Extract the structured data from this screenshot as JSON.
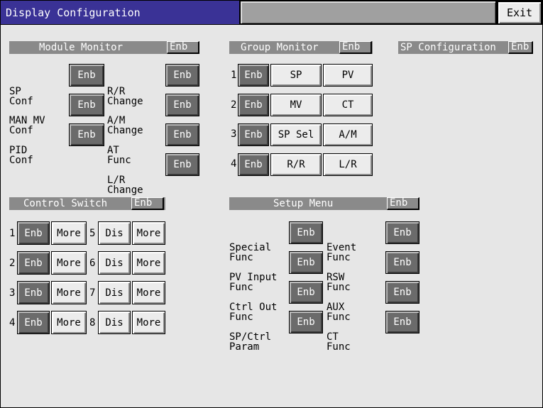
{
  "title_bar": {
    "title": "Display Configuration",
    "exit_label": "Exit"
  },
  "module_monitor": {
    "header": "Module Monitor",
    "header_tag": "Enb",
    "left_items": [
      {
        "l1": "SP",
        "l2": "Conf",
        "state": "Enb"
      },
      {
        "l1": "MAN MV",
        "l2": "Conf",
        "state": "Enb"
      },
      {
        "l1": "PID",
        "l2": "Conf",
        "state": "Enb"
      }
    ],
    "right_items": [
      {
        "l1": "R/R",
        "l2": "Change",
        "state": "Enb"
      },
      {
        "l1": "A/M",
        "l2": "Change",
        "state": "Enb"
      },
      {
        "l1": "AT",
        "l2": "Func",
        "state": "Enb"
      },
      {
        "l1": "L/R",
        "l2": "Change",
        "state": "Enb"
      }
    ]
  },
  "group_monitor": {
    "header": "Group Monitor",
    "header_tag": "Enb",
    "rows": [
      {
        "num": "1",
        "state": "Enb",
        "a": "SP",
        "b": "PV"
      },
      {
        "num": "2",
        "state": "Enb",
        "a": "MV",
        "b": "CT"
      },
      {
        "num": "3",
        "state": "Enb",
        "a": "SP Sel",
        "b": "A/M"
      },
      {
        "num": "4",
        "state": "Enb",
        "a": "R/R",
        "b": "L/R"
      }
    ]
  },
  "sp_configuration": {
    "header": "SP Configuration",
    "header_tag": "Enb"
  },
  "control_switch": {
    "header": "Control Switch",
    "header_tag": "Enb",
    "left_rows": [
      {
        "num": "1",
        "state": "Enb",
        "more": "More"
      },
      {
        "num": "2",
        "state": "Enb",
        "more": "More"
      },
      {
        "num": "3",
        "state": "Enb",
        "more": "More"
      },
      {
        "num": "4",
        "state": "Enb",
        "more": "More"
      }
    ],
    "right_rows": [
      {
        "num": "5",
        "state": "Dis",
        "more": "More"
      },
      {
        "num": "6",
        "state": "Dis",
        "more": "More"
      },
      {
        "num": "7",
        "state": "Dis",
        "more": "More"
      },
      {
        "num": "8",
        "state": "Dis",
        "more": "More"
      }
    ]
  },
  "setup_menu": {
    "header": "Setup Menu",
    "header_tag": "Enb",
    "left_items": [
      {
        "l1": "Special",
        "l2": "Func",
        "state": "Enb"
      },
      {
        "l1": "PV Input",
        "l2": "Func",
        "state": "Enb"
      },
      {
        "l1": "Ctrl Out",
        "l2": "Func",
        "state": "Enb"
      },
      {
        "l1": "SP/Ctrl",
        "l2": "Param",
        "state": "Enb"
      }
    ],
    "right_items": [
      {
        "l1": "Event",
        "l2": "Func",
        "state": "Enb"
      },
      {
        "l1": "RSW",
        "l2": "Func",
        "state": "Enb"
      },
      {
        "l1": "AUX",
        "l2": "Func",
        "state": "Enb"
      },
      {
        "l1": "CT",
        "l2": "Func",
        "state": "Enb"
      }
    ]
  }
}
